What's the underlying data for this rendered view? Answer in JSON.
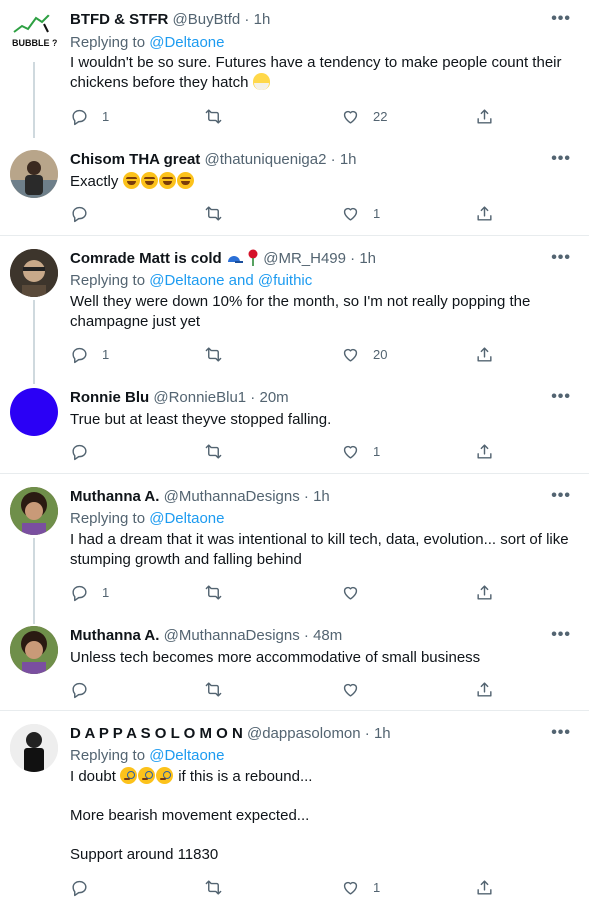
{
  "tweets": [
    {
      "name": "BTFD & STFR",
      "handle": "@BuyBtfd",
      "time": "1h",
      "avatar_label": "BUBBLE ?",
      "reply_prefix": "Replying to",
      "reply_to": "@Deltaone",
      "text1": "I wouldn't be so sure. Futures have a tendency to make people count their",
      "text2": "chickens before they hatch",
      "replies": "1",
      "likes": "22"
    },
    {
      "name": "Chisom THA great",
      "handle": "@thatuniqueniga2",
      "time": "1h",
      "text1": "Exactly",
      "likes": "1"
    },
    {
      "name": "Comrade Matt is cold",
      "handle": "@MR_H499",
      "time": "1h",
      "reply_prefix": "Replying to",
      "reply_to": "@Deltaone and @fuithic",
      "text1": "Well they were down 10% for the month, so I'm not really popping the",
      "text2": "champagne just yet",
      "replies": "1",
      "likes": "20"
    },
    {
      "name": "Ronnie Blu",
      "handle": "@RonnieBlu1",
      "time": "20m",
      "text1": "True but at least theyve stopped falling.",
      "likes": "1"
    },
    {
      "name": "Muthanna A.",
      "handle": "@MuthannaDesigns",
      "time": "1h",
      "reply_prefix": "Replying to",
      "reply_to": "@Deltaone",
      "text1": "I had a dream that it was intentional to kill tech, data, evolution... sort of like",
      "text2": "stumping growth and falling behind",
      "replies": "1"
    },
    {
      "name": "Muthanna A.",
      "handle": "@MuthannaDesigns",
      "time": "48m",
      "text1": "Unless tech becomes more accommodative of small business"
    },
    {
      "name": "D A P P A S O L O M O N",
      "handle": "@dappasolomon",
      "time": "1h",
      "reply_prefix": "Replying to",
      "reply_to": "@Deltaone",
      "text1": "I doubt",
      "text1b": "if this is a rebound...",
      "text2": "More bearish movement expected...",
      "text3": "Support around 11830",
      "likes": "1"
    }
  ],
  "separator": " · ",
  "more_label": "•••",
  "colors": {
    "link": "#1d9bf0",
    "muted": "#536471",
    "ronnie_avatar": "#2b00f5"
  },
  "icons": [
    "reply-icon",
    "retweet-icon",
    "like-icon",
    "share-icon",
    "more-icon"
  ]
}
